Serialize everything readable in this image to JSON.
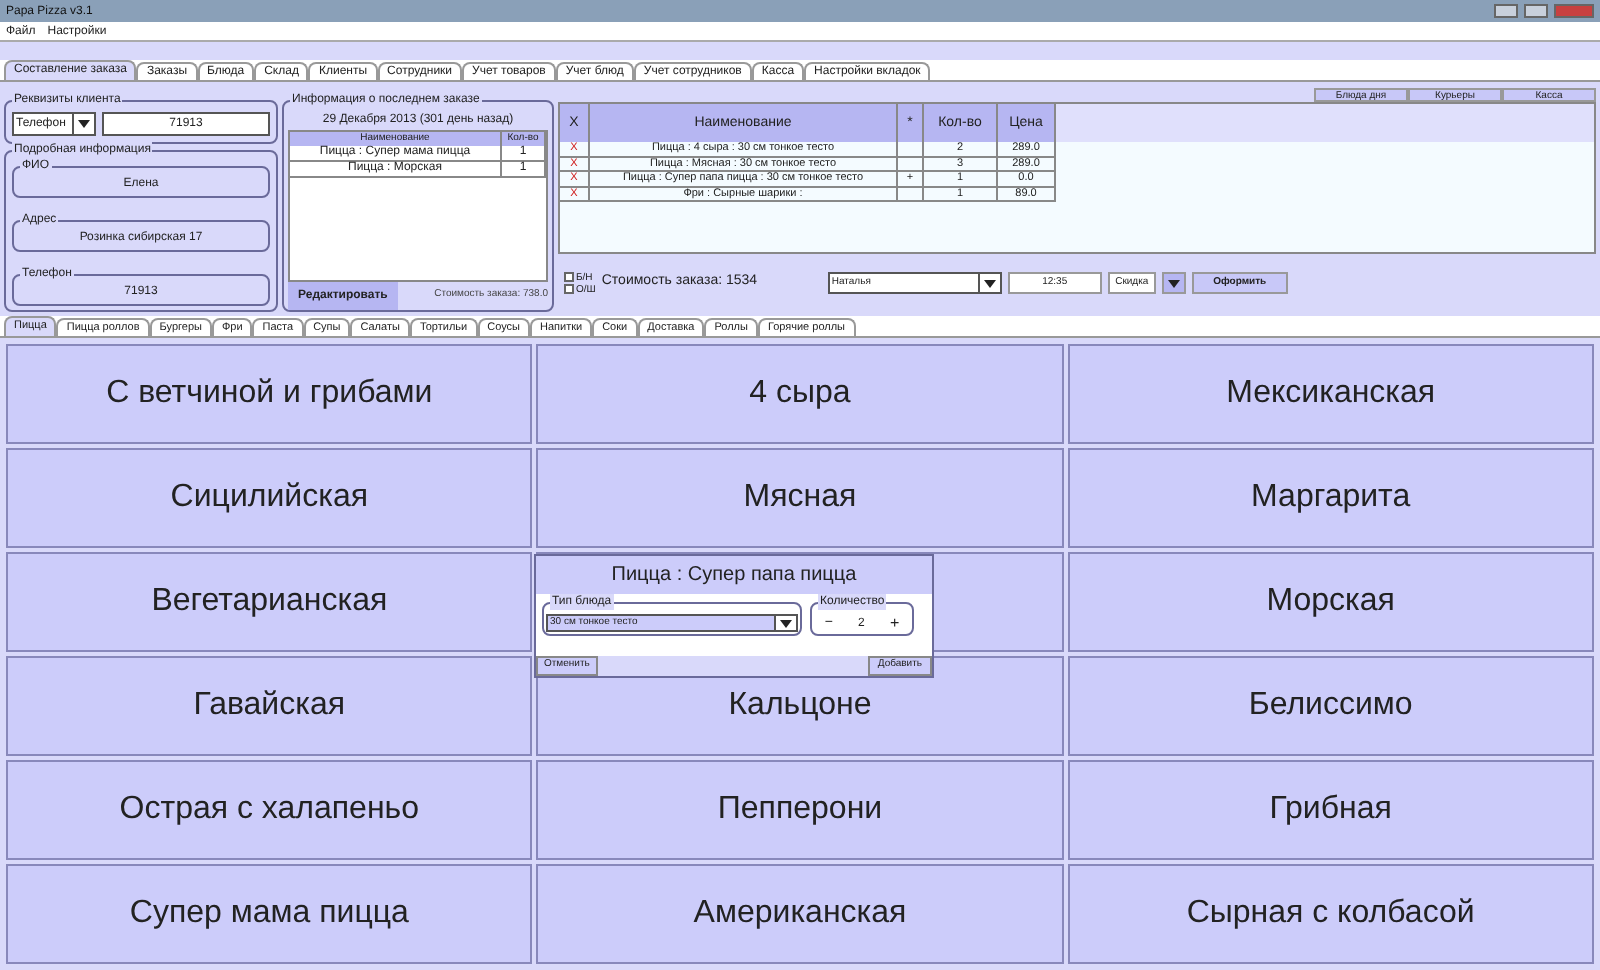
{
  "window": {
    "title": "Papa Pizza v3.1"
  },
  "menu": [
    "Файл",
    "Настройки"
  ],
  "main_tabs": [
    {
      "label": "Составление заказа",
      "selected": true
    },
    {
      "label": "Заказы",
      "selected": false
    },
    {
      "label": "Блюда",
      "selected": false
    },
    {
      "label": "Склад",
      "selected": false
    },
    {
      "label": "Клиенты",
      "selected": false
    },
    {
      "label": "Сотрудники",
      "selected": false
    },
    {
      "label": "Учет товаров",
      "selected": false
    },
    {
      "label": "Учет блюд",
      "selected": false
    },
    {
      "label": "Учет сотрудников",
      "selected": false
    },
    {
      "label": "Касса",
      "selected": false
    },
    {
      "label": "Настройки вкладок",
      "selected": false
    }
  ],
  "side_tabs": [
    "Блюда дня",
    "Курьеры",
    "Касса"
  ],
  "client": {
    "title": "Реквизиты клиента",
    "lookup_type": "Телефон",
    "lookup_value": "71913",
    "details_title": "Подробная информация",
    "fields": [
      {
        "label": "ФИО",
        "value": "Елена"
      },
      {
        "label": "Адрес",
        "value": "Розинка сибирская 17"
      },
      {
        "label": "Телефон",
        "value": "71913"
      }
    ]
  },
  "last_order": {
    "title": "Информация о последнем заказе",
    "date": "29 Декабря 2013 (301 день назад)",
    "columns": [
      "Наименование",
      "Кол-во"
    ],
    "rows": [
      [
        "Пицца : Супер мама пицца",
        "1"
      ],
      [
        "Пицца : Морская",
        "1"
      ]
    ],
    "edit_button": "Редактировать",
    "total": "Стоимость заказа: 738.0"
  },
  "order": {
    "columns": [
      "X",
      "Наименование",
      "*",
      "Кол-во",
      "Цена"
    ],
    "rows": [
      {
        "remove": "X",
        "name": "Пицца : 4 сыра : 30 см тонкое тесто",
        "mark": "",
        "qty": "2",
        "price": "289.0"
      },
      {
        "remove": "X",
        "name": "Пицца : Мясная : 30 см тонкое тесто",
        "mark": "",
        "qty": "3",
        "price": "289.0"
      },
      {
        "remove": "X",
        "name": "Пицца : Супер папа пицца : 30 см тонкое тесто",
        "mark": "+",
        "qty": "1",
        "price": "0.0"
      },
      {
        "remove": "X",
        "name": "Фри : Сырные шарики :",
        "mark": "",
        "qty": "1",
        "price": "89.0"
      }
    ],
    "payment_options": [
      {
        "label": "Б/Н",
        "checked": false
      },
      {
        "label": "О/Ш",
        "checked": false
      }
    ],
    "total": "Стоимость заказа: 1534",
    "courier": "Наталья",
    "time": "12:35",
    "discount": "Скидка",
    "submit": "Оформить"
  },
  "category_tabs": [
    {
      "label": "Пицца",
      "selected": true
    },
    {
      "label": "Пицца роллов",
      "selected": false
    },
    {
      "label": "Бургеры",
      "selected": false
    },
    {
      "label": "Фри",
      "selected": false
    },
    {
      "label": "Паста",
      "selected": false
    },
    {
      "label": "Супы",
      "selected": false
    },
    {
      "label": "Салаты",
      "selected": false
    },
    {
      "label": "Тортильи",
      "selected": false
    },
    {
      "label": "Соусы",
      "selected": false
    },
    {
      "label": "Напитки",
      "selected": false
    },
    {
      "label": "Соки",
      "selected": false
    },
    {
      "label": "Доставка",
      "selected": false
    },
    {
      "label": "Роллы",
      "selected": false
    },
    {
      "label": "Горячие роллы",
      "selected": false
    }
  ],
  "dishes": [
    {
      "label": "С ветчиной и грибами"
    },
    {
      "label": "4 сыра"
    },
    {
      "label": "Мексиканская"
    },
    {
      "label": "Сицилийская"
    },
    {
      "label": "Мясная"
    },
    {
      "label": "Маргарита"
    },
    {
      "label": "Вегетарианская"
    },
    {
      "covered": true
    },
    {
      "label": "Морская"
    },
    {
      "label": "Гавайская"
    },
    {
      "label": "Кальцоне"
    },
    {
      "label": "Белиссимо"
    },
    {
      "label": "Острая с халапеньо"
    },
    {
      "label": "Пепперони"
    },
    {
      "label": "Грибная"
    },
    {
      "label": "Супер мама пицца"
    },
    {
      "label": "Американская"
    },
    {
      "label": "Сырная с колбасой"
    }
  ],
  "dialog": {
    "title": "Пицца : Супер папа пицца",
    "type_label": "Тип блюда",
    "type_value": "30 см тонкое тесто",
    "qty_label": "Количество",
    "minus": "−",
    "qty": "2",
    "plus": "+",
    "cancel": "Отменить",
    "add": "Добавить"
  }
}
